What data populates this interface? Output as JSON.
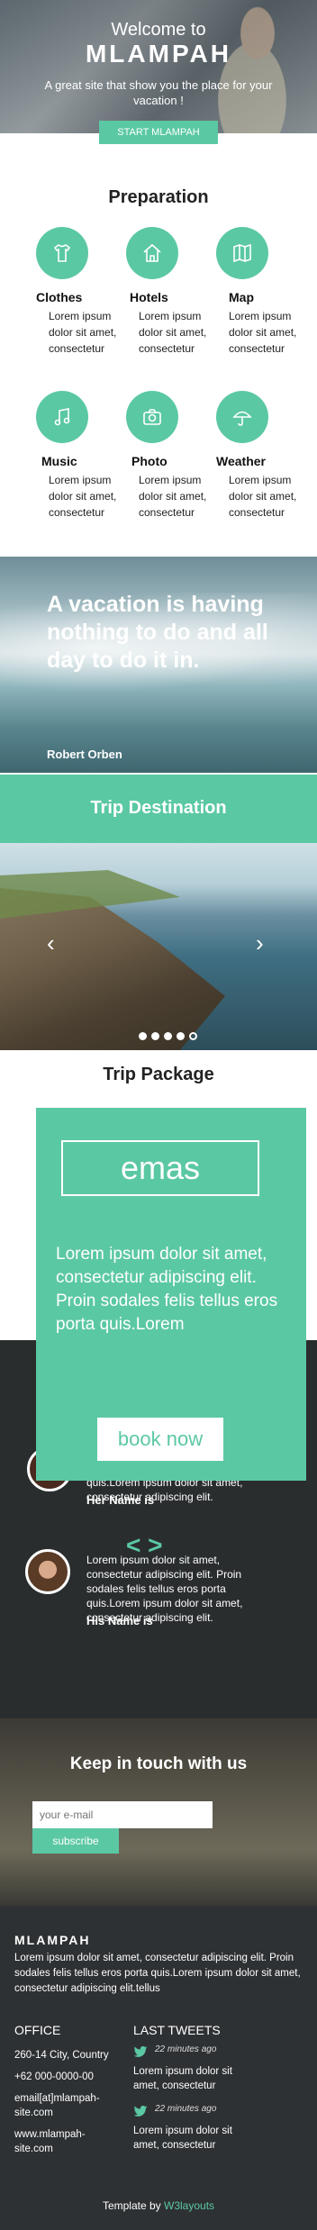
{
  "hero": {
    "welcome": "Welcome to",
    "brand": "MLAMPAH",
    "tagline": "A great site that show you the place for your vacation !",
    "cta": "START MLAMPAH"
  },
  "preparation": {
    "title": "Preparation",
    "items": [
      {
        "icon": "tshirt-icon",
        "label": "Clothes",
        "text": "Lorem ipsum dolor sit amet, consectetur"
      },
      {
        "icon": "home-icon",
        "label": "Hotels",
        "text": "Lorem ipsum dolor sit amet, consectetur"
      },
      {
        "icon": "map-icon",
        "label": "Map",
        "text": "Lorem ipsum dolor sit amet, consectetur"
      },
      {
        "icon": "music-icon",
        "label": "Music",
        "text": "Lorem ipsum dolor sit amet, consectetur"
      },
      {
        "icon": "camera-icon",
        "label": "Photo",
        "text": "Lorem ipsum dolor sit amet, consectetur"
      },
      {
        "icon": "umbrella-icon",
        "label": "Weather",
        "text": "Lorem ipsum dolor sit amet, consectetur"
      }
    ]
  },
  "quote": {
    "text": "A vacation is having nothing to do and all day to do it in.",
    "author": "Robert Orben"
  },
  "destination": {
    "title": "Trip Destination",
    "prev": "‹",
    "next": "›",
    "slide_count": 5
  },
  "package": {
    "title": "Trip Package",
    "name": "emas",
    "description": "Lorem ipsum dolor sit amet, consectetur adipiscing elit. Proin sodales felis tellus eros porta quis.Lorem",
    "book": "book now"
  },
  "testimonials": [
    {
      "text": "Lorem ipsum dolor sit amet, consectetur adipiscing elit. Proin sodales felis tellus eros porta quis.Lorem ipsum dolor sit amet, consectetur adipiscing elit.",
      "name": "Her Name is"
    },
    {
      "text": "Lorem ipsum dolor sit amet, consectetur adipiscing elit. Proin sodales felis tellus eros porta quis.Lorem ipsum dolor sit amet, consectetur adipiscing elit.",
      "name": "His Name is"
    }
  ],
  "newsletter": {
    "title": "Keep in touch with us",
    "placeholder": "your e-mail",
    "button": "subscribe"
  },
  "footer": {
    "brand": "MLAMPAH",
    "about": "Lorem ipsum dolor sit amet, consectetur adipiscing elit. Proin sodales felis tellus eros porta quis.Lorem ipsum dolor sit amet, consectetur adipiscing elit.tellus",
    "office_title": "OFFICE",
    "address": "260-14 City, Country",
    "phone": "+62 000-0000-00",
    "email": "email[at]mlampah-site.com",
    "website": "www.mlampah-site.com",
    "tweets_title": "LAST TWEETS",
    "tweets": [
      {
        "time": "22 minutes ago",
        "text": "Lorem ipsum dolor sit amet, consectetur"
      },
      {
        "time": "22 minutes ago",
        "text": "Lorem ipsum dolor sit amet, consectetur"
      }
    ],
    "credit_prefix": "Template by ",
    "credit_link": "W3layouts"
  },
  "colors": {
    "accent": "#5bc8a4",
    "dark": "#2e3133"
  }
}
